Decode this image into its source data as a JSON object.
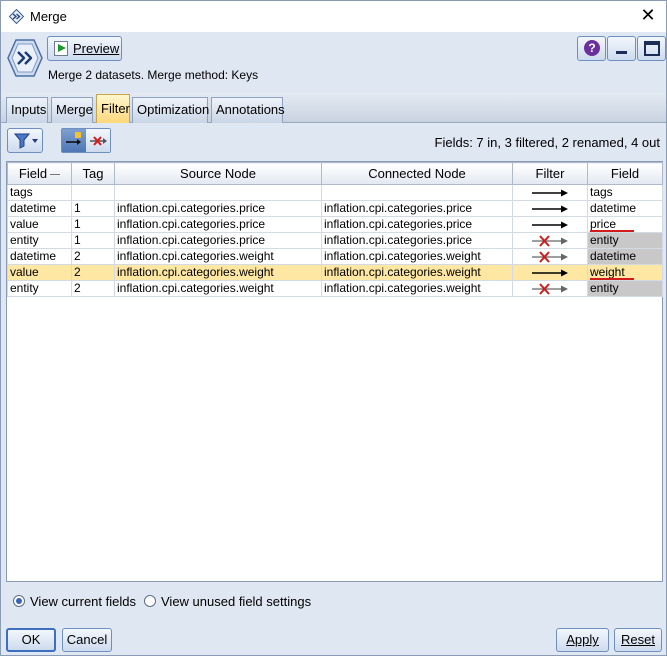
{
  "window": {
    "title": "Merge"
  },
  "header": {
    "preview_label": "Preview",
    "description": "Merge 2 datasets. Merge method: Keys"
  },
  "tabs": [
    {
      "label": "Inputs"
    },
    {
      "label": "Merge"
    },
    {
      "label": "Filter",
      "active": true
    },
    {
      "label": "Optimization"
    },
    {
      "label": "Annotations"
    }
  ],
  "toolbar": {
    "fields_summary": "Fields: 7 in, 3 filtered, 2 renamed, 4 out"
  },
  "table": {
    "columns": [
      "Field",
      "Tag",
      "Source Node",
      "Connected Node",
      "Filter",
      "Field"
    ],
    "rows": [
      {
        "field": "tags",
        "tag": "",
        "source": "",
        "connected": "",
        "filter": "pass",
        "out_field": "tags",
        "greyed": false,
        "renamed": false,
        "highlight": false
      },
      {
        "field": "datetime",
        "tag": "1",
        "source": "inflation.cpi.categories.price",
        "connected": "inflation.cpi.categories.price",
        "filter": "pass",
        "out_field": "datetime",
        "greyed": false,
        "renamed": false,
        "highlight": false
      },
      {
        "field": "value",
        "tag": "1",
        "source": "inflation.cpi.categories.price",
        "connected": "inflation.cpi.categories.price",
        "filter": "pass",
        "out_field": "price",
        "greyed": false,
        "renamed": true,
        "highlight": false
      },
      {
        "field": "entity",
        "tag": "1",
        "source": "inflation.cpi.categories.price",
        "connected": "inflation.cpi.categories.price",
        "filter": "filtered",
        "out_field": "entity",
        "greyed": true,
        "renamed": false,
        "highlight": false
      },
      {
        "field": "datetime",
        "tag": "2",
        "source": "inflation.cpi.categories.weight",
        "connected": "inflation.cpi.categories.weight",
        "filter": "filtered",
        "out_field": "datetime",
        "greyed": true,
        "renamed": false,
        "highlight": false
      },
      {
        "field": "value",
        "tag": "2",
        "source": "inflation.cpi.categories.weight",
        "connected": "inflation.cpi.categories.weight",
        "filter": "pass",
        "out_field": "weight",
        "greyed": false,
        "renamed": true,
        "highlight": true
      },
      {
        "field": "entity",
        "tag": "2",
        "source": "inflation.cpi.categories.weight",
        "connected": "inflation.cpi.categories.weight",
        "filter": "filtered",
        "out_field": "entity",
        "greyed": true,
        "renamed": false,
        "highlight": false
      }
    ]
  },
  "view_options": {
    "current_label": "View current fields",
    "unused_label": "View unused field settings",
    "selected": "current"
  },
  "buttons": {
    "ok": "OK",
    "cancel": "Cancel",
    "apply": "Apply",
    "reset": "Reset"
  },
  "colors": {
    "highlight_row": "#fde7a2",
    "greyed_cell": "#c8c8c8",
    "rename_underline": "#d21b1b",
    "active_tab": "#fcd77a"
  },
  "icons": {
    "title": "merge-node-icon",
    "node": "merge-node-icon",
    "help": "help-icon",
    "filter_pass": "pass-arrow-icon",
    "filter_blocked": "filtered-arrow-icon"
  }
}
